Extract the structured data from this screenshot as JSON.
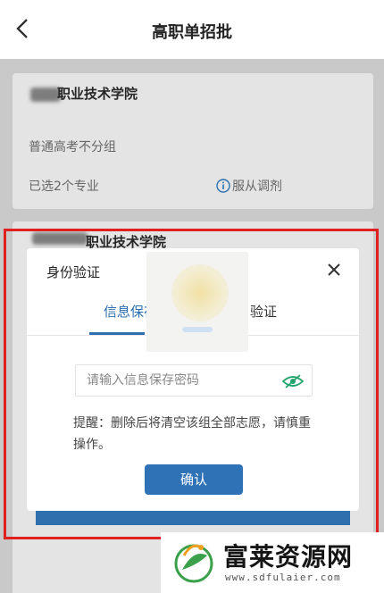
{
  "header": {
    "title": "高职单招批"
  },
  "card1": {
    "school_suffix": "职业技术学院",
    "group_type": "普通高考不分组",
    "selected_count": "已选2个专业",
    "adjust_label": "服从调剂"
  },
  "card2": {
    "school_suffix": "职业技术学院"
  },
  "dialog": {
    "title": "身份验证",
    "tabs": [
      {
        "label": "信息保存",
        "active": true
      },
      {
        "label": "验证",
        "active": false
      }
    ],
    "password_placeholder": "请输入信息保存密码",
    "tip": "提醒：删除后将清空该组全部志愿，请慎重操作。",
    "confirm_label": "确认"
  },
  "watermark": {
    "brand": "富莱资源网",
    "url": "www.sdfulaier.com"
  },
  "colors": {
    "accent": "#2f72b6",
    "highlight_border": "#e02020"
  }
}
